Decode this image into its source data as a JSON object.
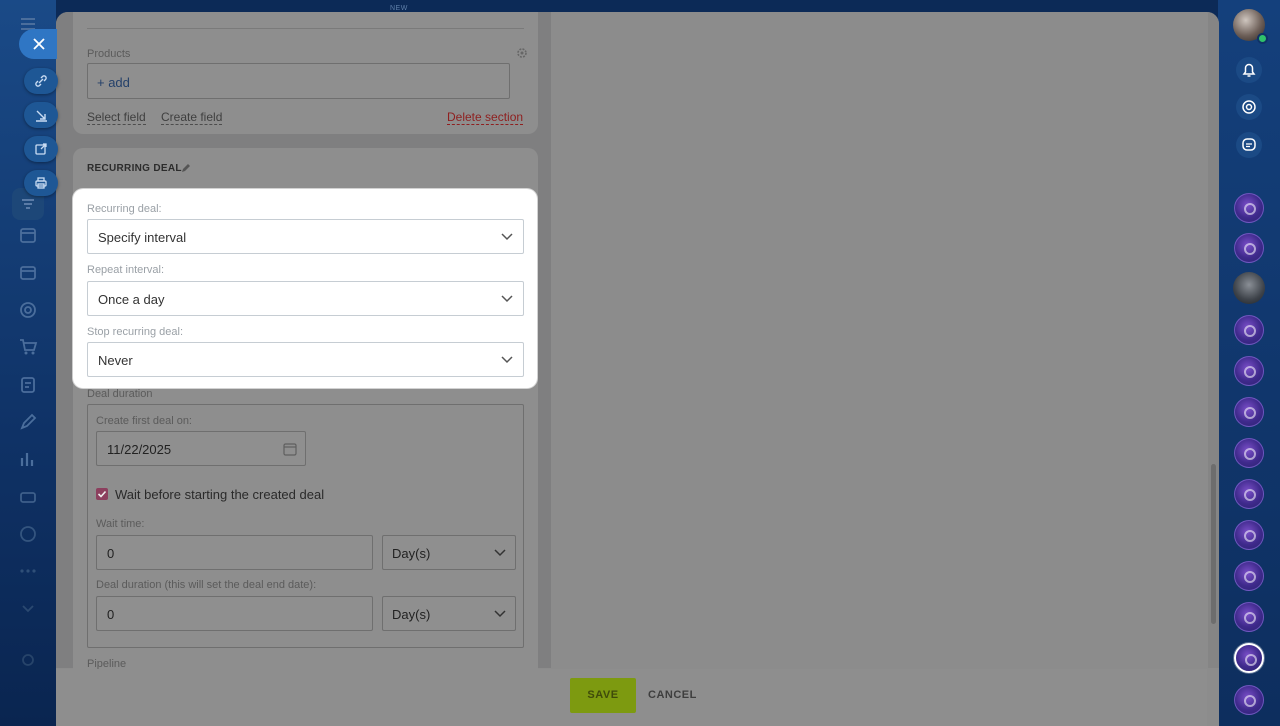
{
  "products_section": {
    "label": "Products",
    "add_label": "+ add",
    "select_field": "Select field",
    "create_field": "Create field",
    "delete_section": "Delete section"
  },
  "recurring_section": {
    "title": "RECURRING DEAL",
    "recurring_label": "Recurring deal:",
    "recurring_value": "Specify interval",
    "repeat_label": "Repeat interval:",
    "repeat_value": "Once a day",
    "stop_label": "Stop recurring deal:",
    "stop_value": "Never",
    "deal_duration_label": "Deal duration",
    "create_first_label": "Create first deal on:",
    "create_first_value": "11/22/2025",
    "wait_checkbox_label": "Wait before starting the created deal",
    "wait_time_label": "Wait time:",
    "wait_time_value": "0",
    "wait_unit": "Day(s)",
    "duration_label": "Deal duration (this will set the deal end date):",
    "duration_value": "0",
    "duration_unit": "Day(s)",
    "pipeline_label": "Pipeline"
  },
  "footer": {
    "save_label": "SAVE",
    "cancel_label": "CANCEL"
  },
  "top_badge": "NEW",
  "colors": {
    "accent_blue": "#2f76c4",
    "save_green": "#bbe31b",
    "checkbox_pink": "#c4487c",
    "nav_dark": "#0c2a57"
  },
  "icons": {
    "close": "close-icon",
    "link": "link-icon",
    "download": "download-icon",
    "external": "external-link-icon",
    "print": "print-icon",
    "bell": "bell-icon",
    "calendar": "calendar-icon",
    "pencil": "pencil-icon",
    "gear": "gear-icon"
  }
}
